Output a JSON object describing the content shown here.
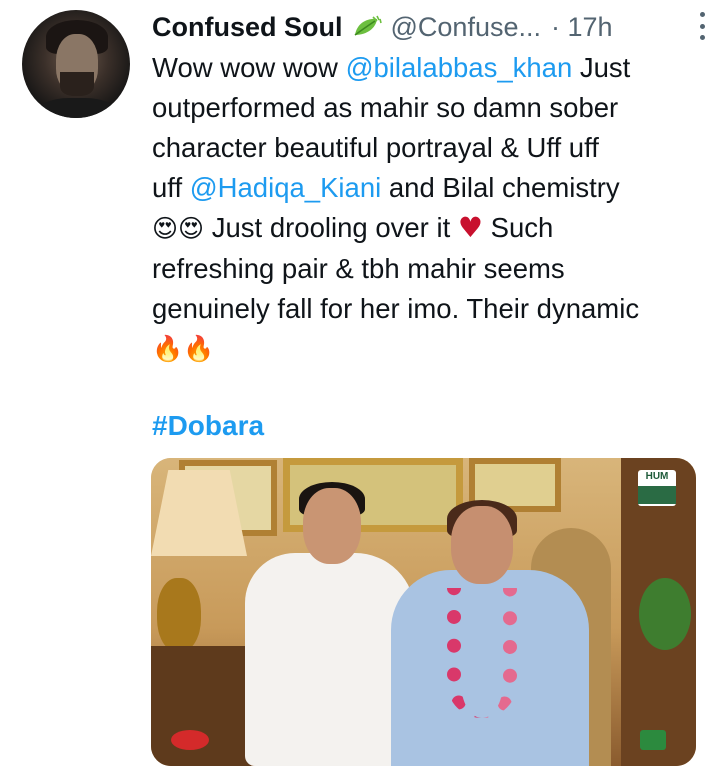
{
  "tweet": {
    "display_name": "Confused Soul",
    "verified_badge_icon": "leaf-emoji-icon",
    "handle": "@Confuse...",
    "time": "· 17h",
    "more_menu_icon": "more-vertical-icon",
    "body": {
      "line1": {
        "text_a": "Wow wow wow ",
        "mention": "@bilalabbas_khan",
        "text_b": " Just"
      },
      "line2": "outperformed as mahir so damn sober",
      "line3": "character beautiful portrayal & Uff uff",
      "line4": {
        "text_a": "uff ",
        "mention": "@Hadiqa_Kiani",
        "text_b": " and Bilal chemistry"
      },
      "line5": {
        "emoji": "😍😍",
        "text_a": " Just drooling over it ",
        "heart": "♥",
        "text_b": " Such"
      },
      "line6": "refreshing pair & tbh mahir seems",
      "line7": "genuinely fall for her imo. Their dynamic",
      "line8_emoji": "🔥🔥"
    },
    "hashtag": "#Dobara",
    "media": {
      "description_icon": "video-still-image",
      "channel_logo_text": "HUM"
    }
  },
  "colors": {
    "link": "#1d9bf0",
    "text": "#0f1419",
    "secondary": "#536471",
    "heart": "#c8102e"
  }
}
